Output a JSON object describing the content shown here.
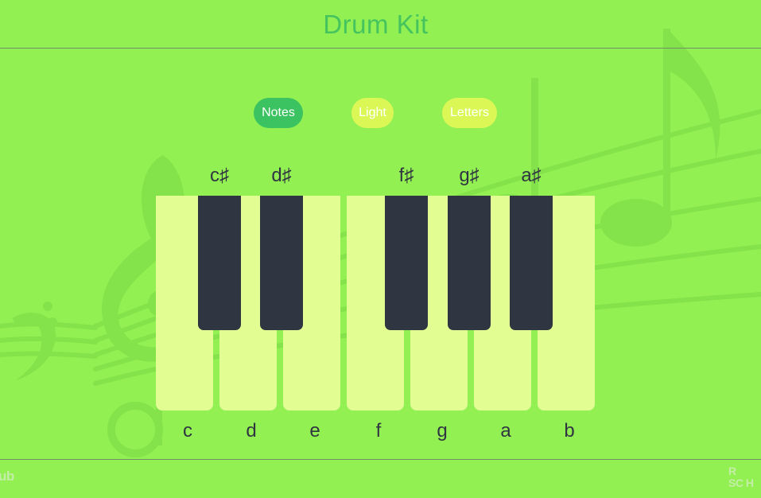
{
  "header": {
    "title": "Drum Kit"
  },
  "modes": {
    "notes_label": "Notes",
    "light_label": "Light",
    "letters_label": "Letters",
    "selected": "Notes"
  },
  "keyboard": {
    "white_keys": [
      "c",
      "d",
      "e",
      "f",
      "g",
      "a",
      "b"
    ],
    "black_keys": [
      "c♯",
      "d♯",
      "f♯",
      "g♯",
      "a♯"
    ]
  },
  "footer": {
    "left_text": "ub",
    "right_text_1": "R",
    "right_text_2": "SC H"
  },
  "colors": {
    "background": "#93f052",
    "title": "#45c35e",
    "selected_button": "#3cc361",
    "button": "#dbf756",
    "white_key": "#e2fd92",
    "black_key": "#303641"
  },
  "icons": {
    "background_art": "music-staff-decoration"
  }
}
